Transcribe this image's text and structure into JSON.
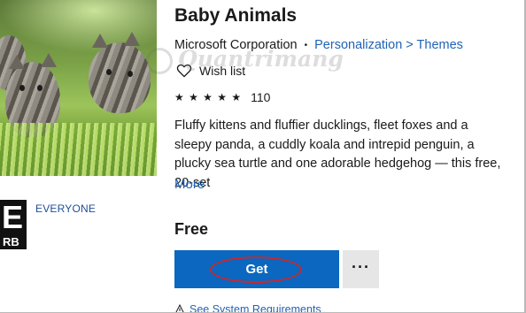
{
  "app": {
    "title": "Baby Animals",
    "publisher": "Microsoft Corporation",
    "separator": "•",
    "category": "Personalization > Themes",
    "wishlist_label": "Wish list",
    "stars": "★ ★ ★ ★ ★",
    "rating_count": "110",
    "description": "Fluffy kittens and fluffier ducklings, fleet foxes and a sleepy panda, a cuddly koala and intrepid penguin, a plucky sea turtle and one adorable hedgehog — this free, 20-set",
    "more_label": "More",
    "price": "Free",
    "get_label": "Get",
    "more_options_label": "···",
    "sysreq_label": "See System Requirements"
  },
  "rating": {
    "esrb_letter": "E",
    "esrb_mark": "RB",
    "label": "EVERYONE"
  },
  "watermark": {
    "text": "Quantrimang"
  },
  "colors": {
    "accent": "#0b67bf",
    "link": "#1f63b4",
    "annotation": "#c9282e"
  }
}
